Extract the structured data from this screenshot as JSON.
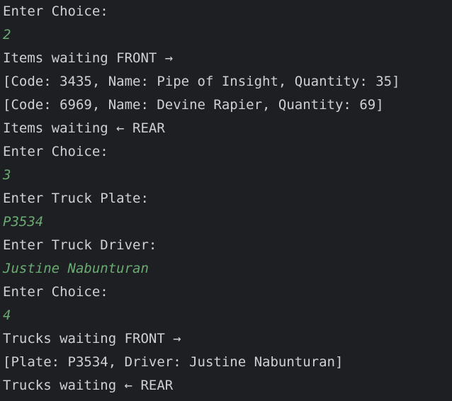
{
  "colors": {
    "background": "#1e1f22",
    "output_text": "#cdd1d6",
    "user_input": "#6aab73"
  },
  "console": {
    "lines": [
      {
        "text": "Enter Choice:",
        "kind": "output"
      },
      {
        "text": "2",
        "kind": "input"
      },
      {
        "text": "Items waiting FRONT →",
        "kind": "output"
      },
      {
        "text": "[Code: 3435, Name: Pipe of Insight, Quantity: 35]",
        "kind": "output"
      },
      {
        "text": "[Code: 6969, Name: Devine Rapier, Quantity: 69]",
        "kind": "output"
      },
      {
        "text": "Items waiting ← REAR",
        "kind": "output"
      },
      {
        "text": "Enter Choice:",
        "kind": "output"
      },
      {
        "text": "3",
        "kind": "input"
      },
      {
        "text": "Enter Truck Plate:",
        "kind": "output"
      },
      {
        "text": "P3534",
        "kind": "input"
      },
      {
        "text": "Enter Truck Driver:",
        "kind": "output"
      },
      {
        "text": "Justine Nabunturan",
        "kind": "input"
      },
      {
        "text": "Enter Choice:",
        "kind": "output"
      },
      {
        "text": "4",
        "kind": "input"
      },
      {
        "text": "Trucks waiting FRONT →",
        "kind": "output"
      },
      {
        "text": "[Plate: P3534, Driver: Justine Nabunturan]",
        "kind": "output"
      },
      {
        "text": "Trucks waiting ← REAR",
        "kind": "output"
      }
    ]
  }
}
